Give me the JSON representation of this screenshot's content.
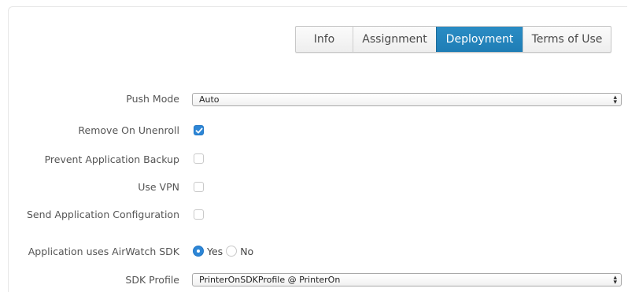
{
  "tabs": [
    {
      "label": "Info",
      "active": false
    },
    {
      "label": "Assignment",
      "active": false
    },
    {
      "label": "Deployment",
      "active": true
    },
    {
      "label": "Terms of Use",
      "active": false
    }
  ],
  "form": {
    "push_mode": {
      "label": "Push Mode",
      "value": "Auto"
    },
    "remove_on_unenroll": {
      "label": "Remove On Unenroll",
      "checked": true
    },
    "prevent_backup": {
      "label": "Prevent Application Backup",
      "checked": false
    },
    "use_vpn": {
      "label": "Use VPN",
      "checked": false
    },
    "send_config": {
      "label": "Send Application Configuration",
      "checked": false
    },
    "uses_sdk": {
      "label": "Application uses AirWatch SDK",
      "options": [
        "Yes",
        "No"
      ],
      "selected": "Yes"
    },
    "sdk_profile": {
      "label": "SDK Profile",
      "value": "PrinterOnSDKProfile @ PrinterOn"
    }
  },
  "colors": {
    "accent": "#2d86d6",
    "tab_active": "#2a8cc4"
  }
}
